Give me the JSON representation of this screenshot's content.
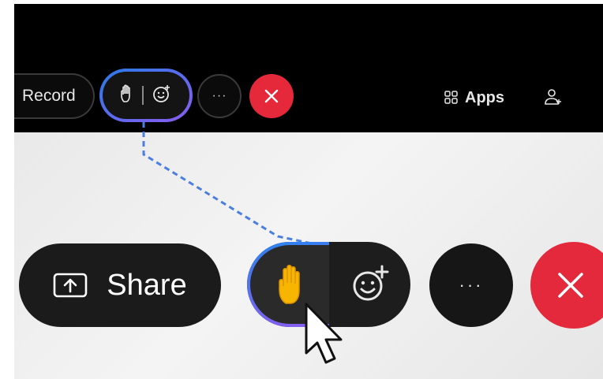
{
  "toolbar": {
    "record_label": "Record",
    "apps_label": "Apps",
    "more_label": "···"
  },
  "controls": {
    "share_label": "Share",
    "more_label": "···"
  },
  "icons": {
    "raise_hand": "raise-hand-icon",
    "reactions": "emoji-add-icon",
    "leave": "close-icon",
    "apps": "apps-grid-icon",
    "participants": "participants-icon",
    "share": "share-screen-icon",
    "cursor": "mouse-pointer-icon"
  },
  "colors": {
    "leave_red": "#e5293a",
    "highlight_gradient_start": "#2a7ae8",
    "highlight_gradient_end": "#8a5cf0",
    "connector_line": "#4a7fe0"
  }
}
